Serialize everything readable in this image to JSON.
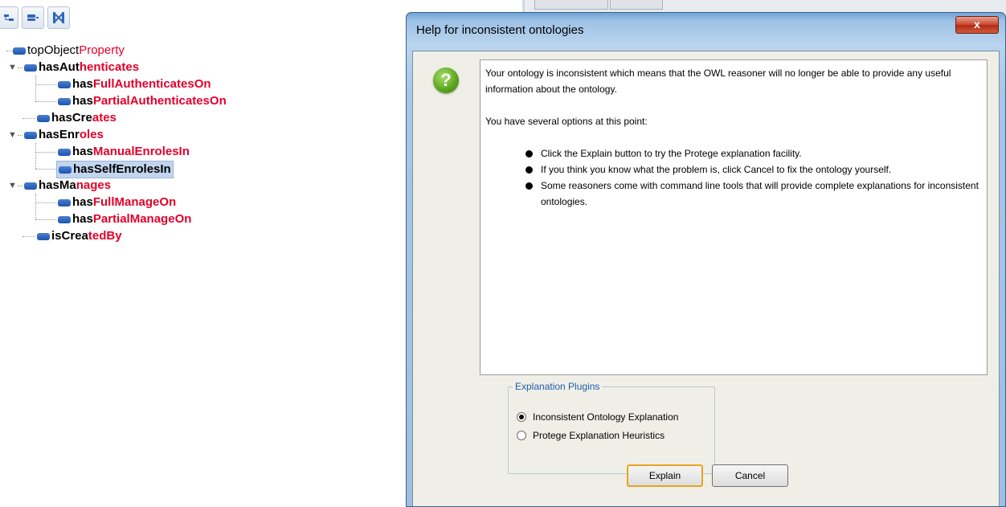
{
  "toolbar": {
    "icons": [
      "add-subproperty-icon",
      "delete-property-icon",
      "disjoint-icon"
    ]
  },
  "tree": {
    "root": {
      "pre": "topObject",
      "suf": "Property"
    },
    "nodes": [
      {
        "pre": "hasAut",
        "suf": "henticates"
      },
      {
        "pre": "has",
        "suf": "FullAuthenticatesOn"
      },
      {
        "pre": "has",
        "suf": "PartialAuthenticatesOn"
      },
      {
        "pre": "hasCre",
        "suf": "ates"
      },
      {
        "pre": "hasEnr",
        "suf": "oles"
      },
      {
        "pre": "has",
        "suf": "ManualEnrolesIn"
      },
      {
        "pre": "hasSelfEnrolesIn",
        "suf": ""
      },
      {
        "pre": "hasMa",
        "suf": "nages"
      },
      {
        "pre": "has",
        "suf": "FullManageOn"
      },
      {
        "pre": "has",
        "suf": "PartialManageOn"
      },
      {
        "pre": "isCrea",
        "suf": "tedBy"
      }
    ]
  },
  "dialog": {
    "title": "Help for inconsistent ontologies",
    "close_label": "x",
    "message": {
      "p1": "Your ontology is inconsistent which means that the OWL reasoner will no longer be able to provide any useful information about the ontology.",
      "p2": "You have several options at this point:",
      "bullets": [
        "Click the Explain button to try the Protege explanation facility.",
        "If you think you know what the problem is, click Cancel to fix the ontology yourself.",
        "Some reasoners come with command line tools that will provide complete explanations for inconsistent ontologies."
      ]
    },
    "plugins": {
      "legend": "Explanation Plugins",
      "options": [
        "Inconsistent Ontology Explanation",
        "Protege Explanation Heuristics"
      ],
      "selected": "Inconsistent Ontology Explanation"
    },
    "buttons": {
      "explain": "Explain",
      "cancel": "Cancel"
    }
  }
}
